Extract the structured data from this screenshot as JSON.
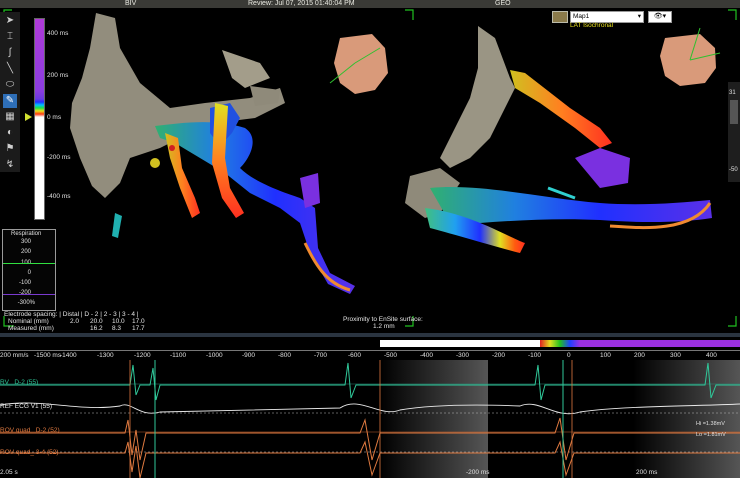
{
  "titlebar": {
    "left": "BIV",
    "center": "Review: Jul 07, 2015 01:40:04 PM",
    "right": "GEO"
  },
  "colors": {
    "accent": "#2e6fb8",
    "scale_top": "#b03ad8",
    "resp_line": "#30e040",
    "ecg_green": "#30c89a",
    "ecg_orange": "#e07030"
  },
  "toolbar": {
    "icons": [
      "pointer-icon",
      "ruler-icon",
      "curve-icon",
      "line-icon",
      "ellipse-icon",
      "pencil-icon",
      "grid-icon",
      "shadow-icon",
      "flag-icon",
      "catheter-icon"
    ]
  },
  "scale": {
    "labels": [
      "400 ms",
      "200 ms",
      "0 ms",
      "-200 ms",
      "-400 ms"
    ]
  },
  "respiration": {
    "title": "Respiration",
    "labels": [
      "300",
      "200",
      "100",
      "0",
      "-100",
      "-200",
      "-300%"
    ]
  },
  "electrode": {
    "header": "Electrode spacing: | Distal | D - 2 | 2 - 3 | 3 - 4 |",
    "nominal_label": "Nominal (mm)",
    "nominal_values": [
      "2.0",
      "20.0",
      "10.0",
      "17.0"
    ],
    "measured_label": "Measured (mm)",
    "measured_values": [
      "16.2",
      "8.3",
      "17.7"
    ]
  },
  "proximity": {
    "line1": "Proximity to EnSite surface:",
    "line2": "1.2 mm"
  },
  "map_panel": {
    "selected": "Map1",
    "subtitle": "LAT Isochronal",
    "right_labels": [
      "31",
      "-50"
    ]
  },
  "timeline": {
    "speed": "200 mm/s",
    "ticks": [
      "-1500 ms",
      "-1400",
      "-1300",
      "-1200",
      "-1100",
      "-1000",
      "-900",
      "-800",
      "-700",
      "-600",
      "-500",
      "-400",
      "-300",
      "-200",
      "-100",
      "0",
      "100",
      "200",
      "300",
      "400"
    ]
  },
  "ecg": {
    "channels": [
      "RV_ D-2 (55)",
      "REF ECG V1 (55)",
      "ROV quad_ D-2 (52)",
      "ROV quad_ 3-4 (52)"
    ],
    "footer_left": "2.05 s",
    "markers": [
      "-200 ms",
      "200 ms"
    ],
    "hi_label": "Hi =1.38mV",
    "lo_label": "Lo =1.81mV"
  }
}
